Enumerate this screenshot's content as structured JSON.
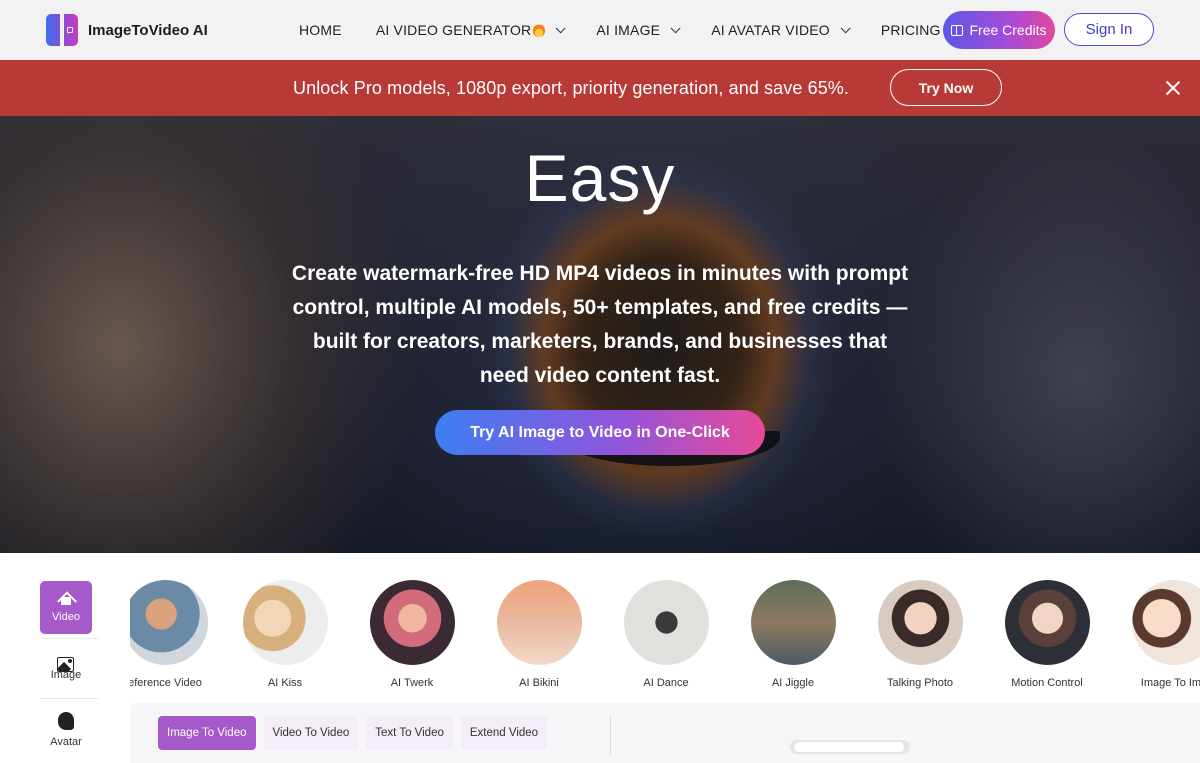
{
  "nav": {
    "logo_text": "ImageToVideo AI",
    "items": [
      {
        "label": "HOME",
        "has_dropdown": false
      },
      {
        "label": "AI VIDEO GENERATOR",
        "has_dropdown": true,
        "badge_icon": "fire-icon"
      },
      {
        "label": "AI IMAGE",
        "has_dropdown": true
      },
      {
        "label": "AI AVATAR VIDEO",
        "has_dropdown": true
      },
      {
        "label": "PRICING",
        "has_dropdown": false
      }
    ],
    "free_credits_label": "Free Credits",
    "sign_in_label": "Sign In"
  },
  "promo": {
    "text": "Unlock Pro models, 1080p export, priority generation, and save 65%.",
    "cta_label": "Try Now",
    "background": "#b83a37"
  },
  "hero": {
    "title": "Easy",
    "subtitle": "Create watermark-free HD MP4 videos in minutes with prompt control, multiple AI models, 50+ templates, and free credits — built for creators, marketers, brands, and businesses that need video content fast.",
    "cta_label": "Try AI Image to Video in One-Click"
  },
  "sidebar": {
    "tabs": [
      {
        "label": "Video",
        "icon": "home-icon",
        "active": true
      },
      {
        "label": "Image",
        "icon": "image-icon",
        "active": false
      },
      {
        "label": "Avatar",
        "icon": "avatar-icon",
        "active": false
      }
    ]
  },
  "templates": [
    {
      "label": "eference Video"
    },
    {
      "label": "AI Kiss"
    },
    {
      "label": "AI Twerk"
    },
    {
      "label": "AI Bikini"
    },
    {
      "label": "AI Dance"
    },
    {
      "label": "AI Jiggle"
    },
    {
      "label": "Talking Photo"
    },
    {
      "label": "Motion Control"
    },
    {
      "label": "Image To Ima"
    }
  ],
  "modes": [
    {
      "label": "Image To Video",
      "active": true
    },
    {
      "label": "Video To Video",
      "active": false
    },
    {
      "label": "Text To Video",
      "active": false
    },
    {
      "label": "Extend Video",
      "active": false
    }
  ],
  "colors": {
    "accent_purple": "#a659c9",
    "brand_gradient_start": "#3d7ef2",
    "brand_gradient_end": "#e84a98"
  }
}
